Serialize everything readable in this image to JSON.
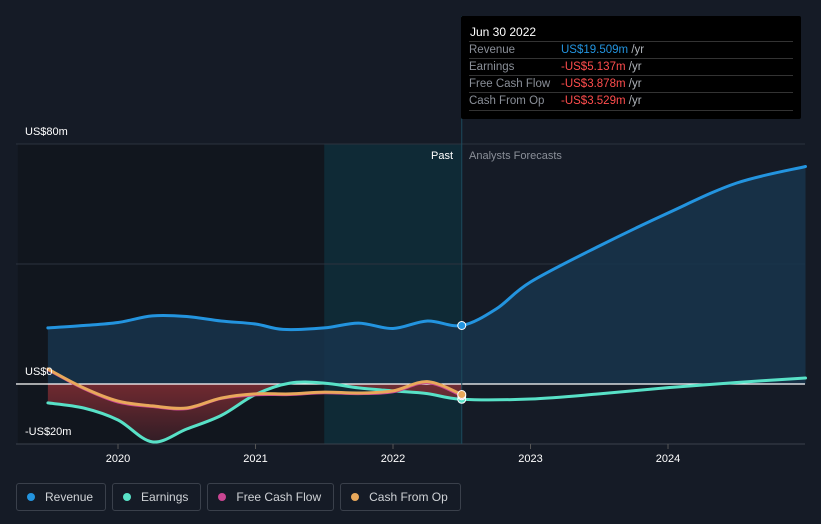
{
  "tooltip": {
    "date": "Jun 30 2022",
    "unit": "/yr",
    "rows": [
      {
        "label": "Revenue",
        "value": "US$19.509m",
        "color": "#2394df"
      },
      {
        "label": "Earnings",
        "value": "-US$5.137m",
        "color": "#ff4d4d"
      },
      {
        "label": "Free Cash Flow",
        "value": "-US$3.878m",
        "color": "#ff4d4d"
      },
      {
        "label": "Cash From Op",
        "value": "-US$3.529m",
        "color": "#ff4d4d"
      }
    ]
  },
  "chart_data": {
    "type": "line",
    "y_tick_labels": [
      "US$80m",
      "US$0",
      "-US$20m"
    ],
    "ylim": [
      -20,
      80
    ],
    "xlim": [
      2019.49,
      2025.0
    ],
    "x_ticks": [
      2020,
      2021,
      2022,
      2023,
      2024
    ],
    "x_tick_labels": [
      "2020",
      "2021",
      "2022",
      "2023",
      "2024"
    ],
    "past_label": "Past",
    "forecast_label": "Analysts Forecasts",
    "divider_x": 2022.5,
    "series": [
      {
        "name": "Revenue",
        "color": "#2394df",
        "x": [
          2019.49,
          2019.75,
          2020,
          2020.25,
          2020.5,
          2020.75,
          2021,
          2021.2,
          2021.5,
          2021.75,
          2022,
          2022.25,
          2022.5,
          2022.75,
          2023,
          2023.5,
          2024,
          2024.5,
          2025
        ],
        "values": [
          18.7,
          19.5,
          20.5,
          22.7,
          22.5,
          21,
          20,
          18.2,
          18.7,
          20.3,
          18.5,
          21,
          19.5,
          25,
          34,
          46,
          57,
          67,
          72.5
        ]
      },
      {
        "name": "Earnings",
        "color": "#58e1c7",
        "x": [
          2019.49,
          2019.75,
          2020,
          2020.25,
          2020.5,
          2020.75,
          2021,
          2021.25,
          2021.5,
          2021.75,
          2022,
          2022.25,
          2022.5,
          2023,
          2023.5,
          2024,
          2024.5,
          2025
        ],
        "values": [
          -6.3,
          -8,
          -12,
          -19.3,
          -15,
          -10.5,
          -3.5,
          0.3,
          0.3,
          -1.3,
          -2.3,
          -3.2,
          -5.1,
          -5,
          -3.3,
          -1.2,
          0.5,
          2
        ]
      },
      {
        "name": "Free Cash Flow",
        "color": "#c94592",
        "x": [
          2019.49,
          2019.75,
          2020,
          2020.25,
          2020.5,
          2020.75,
          2021,
          2021.25,
          2021.5,
          2021.75,
          2022,
          2022.25,
          2022.5
        ],
        "values": [
          4.8,
          -1.5,
          -6,
          -7.5,
          -8.2,
          -4.8,
          -3.6,
          -3.5,
          -2.9,
          -3.2,
          -2.6,
          0.5,
          -3.9
        ]
      },
      {
        "name": "Cash From Op",
        "color": "#e8a85b",
        "x": [
          2019.49,
          2019.75,
          2020,
          2020.25,
          2020.5,
          2020.75,
          2021,
          2021.25,
          2021.5,
          2021.75,
          2022,
          2022.25,
          2022.5
        ],
        "values": [
          5,
          -1.3,
          -5.7,
          -7.3,
          -8,
          -4.7,
          -3.3,
          -3.3,
          -2.7,
          -3,
          -2.3,
          0.8,
          -3.5
        ]
      }
    ]
  },
  "legend": [
    {
      "label": "Revenue",
      "color": "#2394df"
    },
    {
      "label": "Earnings",
      "color": "#58e1c7"
    },
    {
      "label": "Free Cash Flow",
      "color": "#c94592"
    },
    {
      "label": "Cash From Op",
      "color": "#e8a85b"
    }
  ]
}
